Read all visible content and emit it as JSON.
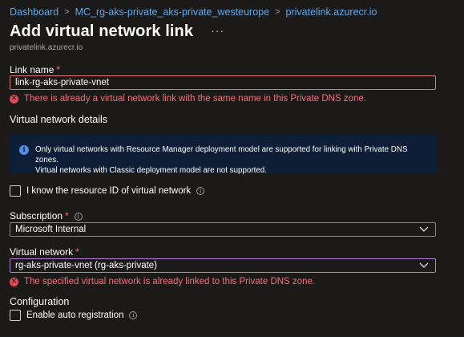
{
  "breadcrumb": {
    "items": [
      "Dashboard",
      "MC_rg-aks-private_aks-private_westeurope",
      "privatelink.azurecr.io"
    ]
  },
  "page": {
    "title": "Add virtual network link",
    "more": "···",
    "subtitle": "privatelink.azurecr.io"
  },
  "link_name": {
    "label": "Link name",
    "required_mark": "*",
    "value": "link-rg-aks-private-vnet",
    "error": "There is already a virtual network link with the same name in this Private DNS zone."
  },
  "vnet_details": {
    "heading": "Virtual network details",
    "info_line1": "Only virtual networks with Resource Manager deployment model are supported for linking with Private DNS zones.",
    "info_line2": "Virtual networks with Classic deployment model are not supported."
  },
  "know_resource_id": {
    "label": "I know the resource ID of virtual network",
    "checked": false
  },
  "subscription": {
    "label": "Subscription",
    "required_mark": "*",
    "value": "Microsoft Internal"
  },
  "virtual_network": {
    "label": "Virtual network",
    "required_mark": "*",
    "value": "rg-aks-private-vnet (rg-aks-private)",
    "error": "The specified virtual network is already linked to this Private DNS zone."
  },
  "configuration": {
    "heading": "Configuration",
    "auto_registration_label": "Enable auto registration",
    "auto_registration_checked": false
  },
  "colors": {
    "background": "#1b1a19",
    "link": "#5aa9ee",
    "error": "#f1707b",
    "info_bg": "#0d1e36",
    "focus": "#b480d9"
  }
}
